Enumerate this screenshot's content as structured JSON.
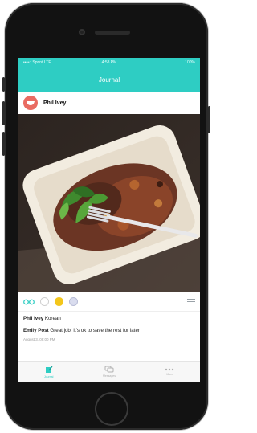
{
  "status_bar": {
    "carrier": "••••○ Sprint LTE",
    "time": "4:58 PM",
    "battery": "100%"
  },
  "nav": {
    "title": "Journal"
  },
  "post": {
    "author": "Phil Ivey",
    "photo_description": "food-container-photo"
  },
  "actions": {
    "icons": [
      "glasses-icon",
      "empty-circle",
      "yellow-circle",
      "blue-circle"
    ]
  },
  "comments": [
    {
      "author": "Phil Ivey",
      "text": "Korean"
    },
    {
      "author": "Emily Post",
      "text": "Great job! It's ok to save the rest for later"
    }
  ],
  "timestamp": "August 3, 09:00 PM",
  "tabs": [
    {
      "label": "Journal",
      "icon": "journal-icon",
      "active": true
    },
    {
      "label": "Messages",
      "icon": "chat-icon",
      "active": false
    },
    {
      "label": "More",
      "icon": "more-icon",
      "active": false
    }
  ],
  "colors": {
    "accent": "#2ecdc3",
    "avatar": "#e96b62",
    "reaction_yellow": "#f3c61b"
  }
}
